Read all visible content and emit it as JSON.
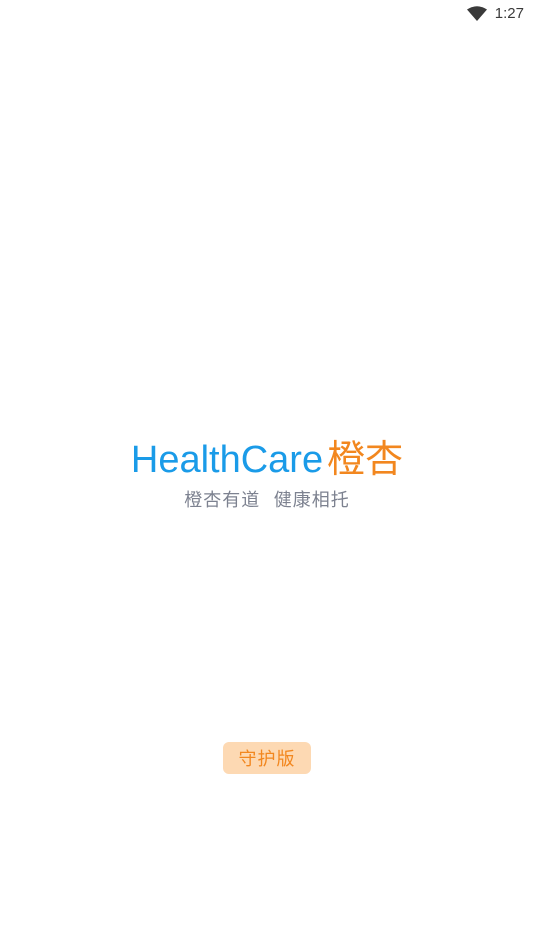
{
  "status_bar": {
    "time": "1:27",
    "wifi_icon": "wifi-icon"
  },
  "brand": {
    "name_en": "HealthCare",
    "name_cn": "橙杏",
    "colors": {
      "en": "#1a9be8",
      "cn": "#f2871f"
    }
  },
  "slogan": "橙杏有道  健康相托",
  "edition": {
    "label": "守护版",
    "colors": {
      "text": "#f2871f",
      "background": "#fdd9b3"
    }
  }
}
